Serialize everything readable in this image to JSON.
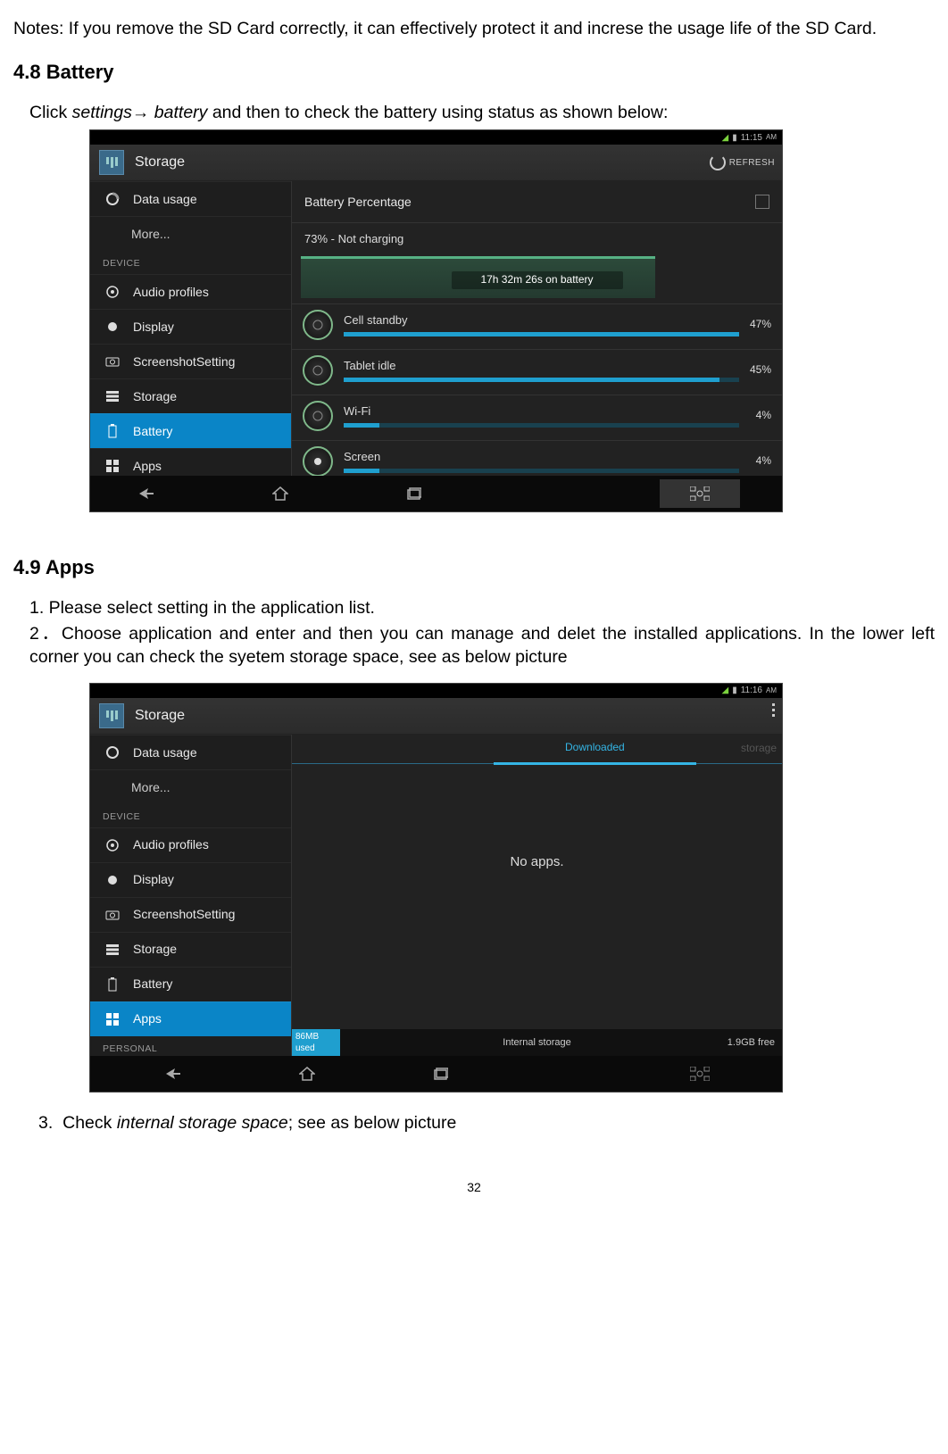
{
  "notes": "Notes: If you remove the SD Card correctly, it can effectively protect it and increse the usage life of the SD Card.",
  "h48": "4.8 Battery",
  "click48_a": "Click ",
  "click48_b": "settings",
  "click48_c": " battery",
  "click48_d": " and then to check the battery using status as shown below:",
  "arrow": "→",
  "h49": "4.9 Apps",
  "li1": "1. Please select setting in the application list.",
  "li2a": "2．",
  "li2b": "Choose application and enter and then you can manage and delet the installed applications. In the lower left corner you can check the syetem storage space, see as below picture",
  "li3a": "3.",
  "li3b": "Check ",
  "li3c": "internal storage space",
  "li3d": "; see as below picture",
  "page": "32",
  "status_time": "11:15",
  "status_ampm": "AM",
  "title": "Storage",
  "refresh": "REFRESH",
  "side": {
    "data_usage": "Data usage",
    "more": "More...",
    "device": "DEVICE",
    "audio": "Audio profiles",
    "display": "Display",
    "sshot": "ScreenshotSetting",
    "storage": "Storage",
    "battery": "Battery",
    "apps": "Apps",
    "personal": "PERSONAL"
  },
  "batt": {
    "pct_label": "Battery Percentage",
    "status": "73% - Not charging",
    "onbatt": "17h 32m 26s on battery",
    "rows": [
      {
        "name": "Cell standby",
        "pct": "47%",
        "fill": 100
      },
      {
        "name": "Tablet idle",
        "pct": "45%",
        "fill": 95
      },
      {
        "name": "Wi-Fi",
        "pct": "4%",
        "fill": 9
      },
      {
        "name": "Screen",
        "pct": "4%",
        "fill": 9
      }
    ]
  },
  "apps": {
    "tab_dl": "Downloaded",
    "tab_st": "storage",
    "noapps": "No apps.",
    "int_storage": "Internal storage",
    "used": "86MB used",
    "free": "1.9GB free"
  },
  "status_time2": "11:16"
}
